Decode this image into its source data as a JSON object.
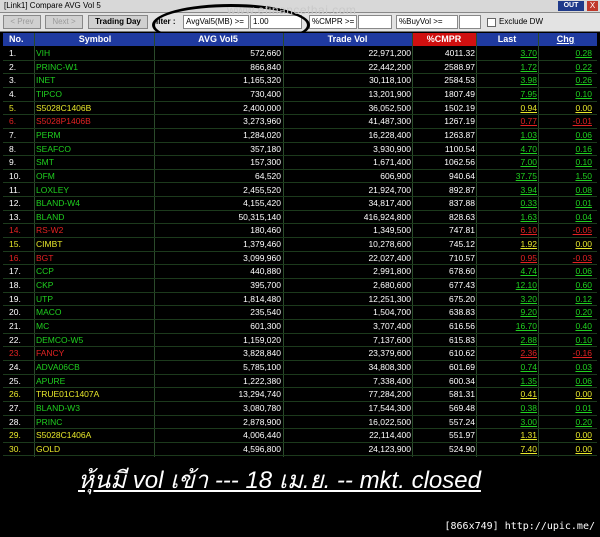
{
  "window": {
    "title": "[Link1] Compare AVG Vol 5",
    "out_label": "OUT",
    "close_label": "X"
  },
  "toolbar": {
    "prev_label": "< Prev",
    "next_label": "Next >",
    "trading_day_label": "Trading Day",
    "filter_label": "ilter :",
    "filter_field": "AvgVal5(MB) >=",
    "filter_value": "1.00",
    "cmpr_field": "%CMPR >=",
    "cmpr_value": "",
    "buyvol_field": "%BuyVol >=",
    "exclude_label": "Exclude DW"
  },
  "watermark": "www.efinancethai.com",
  "columns": {
    "no": "No.",
    "symbol": "Symbol",
    "avg": "AVG Vol5",
    "tv": "Trade Vol",
    "cmpr": "%CMPR",
    "last": "Last",
    "chg": "Chg"
  },
  "rows": [
    {
      "no": "1.",
      "sym": "VIH",
      "avg": "572,660",
      "tv": "22,971,200",
      "cmpr": "4011.32",
      "last": "3.70",
      "chg": "0.28",
      "c": "g"
    },
    {
      "no": "2.",
      "sym": "PRINC-W1",
      "avg": "866,840",
      "tv": "22,442,200",
      "cmpr": "2588.97",
      "last": "1.72",
      "chg": "0.22",
      "c": "g"
    },
    {
      "no": "3.",
      "sym": "INET",
      "avg": "1,165,320",
      "tv": "30,118,100",
      "cmpr": "2584.53",
      "last": "3.98",
      "chg": "0.26",
      "c": "g"
    },
    {
      "no": "4.",
      "sym": "TIPCO",
      "avg": "730,400",
      "tv": "13,201,900",
      "cmpr": "1807.49",
      "last": "7.95",
      "chg": "0.10",
      "c": "g"
    },
    {
      "no": "5.",
      "sym": "S5028C1406B",
      "avg": "2,400,000",
      "tv": "36,052,500",
      "cmpr": "1502.19",
      "last": "0.94",
      "chg": "0.00",
      "c": "y"
    },
    {
      "no": "6.",
      "sym": "S5028P1406B",
      "avg": "3,273,960",
      "tv": "41,487,300",
      "cmpr": "1267.19",
      "last": "0.77",
      "chg": "-0.01",
      "c": "r"
    },
    {
      "no": "7.",
      "sym": "PERM",
      "avg": "1,284,020",
      "tv": "16,228,400",
      "cmpr": "1263.87",
      "last": "1.03",
      "chg": "0.06",
      "c": "g"
    },
    {
      "no": "8.",
      "sym": "SEAFCO",
      "avg": "357,180",
      "tv": "3,930,900",
      "cmpr": "1100.54",
      "last": "4.70",
      "chg": "0.16",
      "c": "g"
    },
    {
      "no": "9.",
      "sym": "SMT",
      "avg": "157,300",
      "tv": "1,671,400",
      "cmpr": "1062.56",
      "last": "7.00",
      "chg": "0.10",
      "c": "g"
    },
    {
      "no": "10.",
      "sym": "OFM",
      "avg": "64,520",
      "tv": "606,900",
      "cmpr": "940.64",
      "last": "37.75",
      "chg": "1.50",
      "c": "g"
    },
    {
      "no": "11.",
      "sym": "LOXLEY",
      "avg": "2,455,520",
      "tv": "21,924,700",
      "cmpr": "892.87",
      "last": "3.94",
      "chg": "0.08",
      "c": "g"
    },
    {
      "no": "12.",
      "sym": "BLAND-W4",
      "avg": "4,155,420",
      "tv": "34,817,400",
      "cmpr": "837.88",
      "last": "0.33",
      "chg": "0.01",
      "c": "g"
    },
    {
      "no": "13.",
      "sym": "BLAND",
      "avg": "50,315,140",
      "tv": "416,924,800",
      "cmpr": "828.63",
      "last": "1.63",
      "chg": "0.04",
      "c": "g"
    },
    {
      "no": "14.",
      "sym": "RS-W2",
      "avg": "180,460",
      "tv": "1,349,500",
      "cmpr": "747.81",
      "last": "6.10",
      "chg": "-0.05",
      "c": "r"
    },
    {
      "no": "15.",
      "sym": "CIMBT",
      "avg": "1,379,460",
      "tv": "10,278,600",
      "cmpr": "745.12",
      "last": "1.92",
      "chg": "0.00",
      "c": "y"
    },
    {
      "no": "16.",
      "sym": "BGT",
      "avg": "3,099,960",
      "tv": "22,027,400",
      "cmpr": "710.57",
      "last": "0.95",
      "chg": "-0.03",
      "c": "r"
    },
    {
      "no": "17.",
      "sym": "CCP",
      "avg": "440,880",
      "tv": "2,991,800",
      "cmpr": "678.60",
      "last": "4.74",
      "chg": "0.06",
      "c": "g"
    },
    {
      "no": "18.",
      "sym": "CKP",
      "avg": "395,700",
      "tv": "2,680,600",
      "cmpr": "677.43",
      "last": "12.10",
      "chg": "0.60",
      "c": "g"
    },
    {
      "no": "19.",
      "sym": "UTP",
      "avg": "1,814,480",
      "tv": "12,251,300",
      "cmpr": "675.20",
      "last": "3.20",
      "chg": "0.12",
      "c": "g"
    },
    {
      "no": "20.",
      "sym": "MACO",
      "avg": "235,540",
      "tv": "1,504,700",
      "cmpr": "638.83",
      "last": "9.20",
      "chg": "0.20",
      "c": "g"
    },
    {
      "no": "21.",
      "sym": "MC",
      "avg": "601,300",
      "tv": "3,707,400",
      "cmpr": "616.56",
      "last": "16.70",
      "chg": "0.40",
      "c": "g"
    },
    {
      "no": "22.",
      "sym": "DEMCO-W5",
      "avg": "1,159,020",
      "tv": "7,137,600",
      "cmpr": "615.83",
      "last": "2.88",
      "chg": "0.10",
      "c": "g"
    },
    {
      "no": "23.",
      "sym": "FANCY",
      "avg": "3,828,840",
      "tv": "23,379,600",
      "cmpr": "610.62",
      "last": "2.36",
      "chg": "-0.16",
      "c": "r"
    },
    {
      "no": "24.",
      "sym": "ADVA06CB",
      "avg": "5,785,100",
      "tv": "34,808,300",
      "cmpr": "601.69",
      "last": "0.74",
      "chg": "0.03",
      "c": "g"
    },
    {
      "no": "25.",
      "sym": "APURE",
      "avg": "1,222,380",
      "tv": "7,338,400",
      "cmpr": "600.34",
      "last": "1.35",
      "chg": "0.06",
      "c": "g"
    },
    {
      "no": "26.",
      "sym": "TRUE01C1407A",
      "avg": "13,294,740",
      "tv": "77,284,200",
      "cmpr": "581.31",
      "last": "0.41",
      "chg": "0.00",
      "c": "y"
    },
    {
      "no": "27.",
      "sym": "BLAND-W3",
      "avg": "3,080,780",
      "tv": "17,544,300",
      "cmpr": "569.48",
      "last": "0.38",
      "chg": "0.01",
      "c": "g"
    },
    {
      "no": "28.",
      "sym": "PRINC",
      "avg": "2,878,900",
      "tv": "16,022,500",
      "cmpr": "557.24",
      "last": "3.00",
      "chg": "0.20",
      "c": "g"
    },
    {
      "no": "29.",
      "sym": "S5028C1406A",
      "avg": "4,006,440",
      "tv": "22,114,400",
      "cmpr": "551.97",
      "last": "1.31",
      "chg": "0.00",
      "c": "y"
    },
    {
      "no": "30.",
      "sym": "GOLD",
      "avg": "4,596,800",
      "tv": "24,123,900",
      "cmpr": "524.90",
      "last": "7.40",
      "chg": "0.00",
      "c": "y"
    }
  ],
  "caption": "หุ้นมี vol เข้า --- 18 เม.ย. -- mkt. closed",
  "stamp": "[866x749] http://upic.me/",
  "colors": {
    "up": "#1fd11f",
    "flat": "#e8e82a",
    "down": "#e22222",
    "header": "#1f3aa0",
    "cmpr_header": "#d01010"
  }
}
